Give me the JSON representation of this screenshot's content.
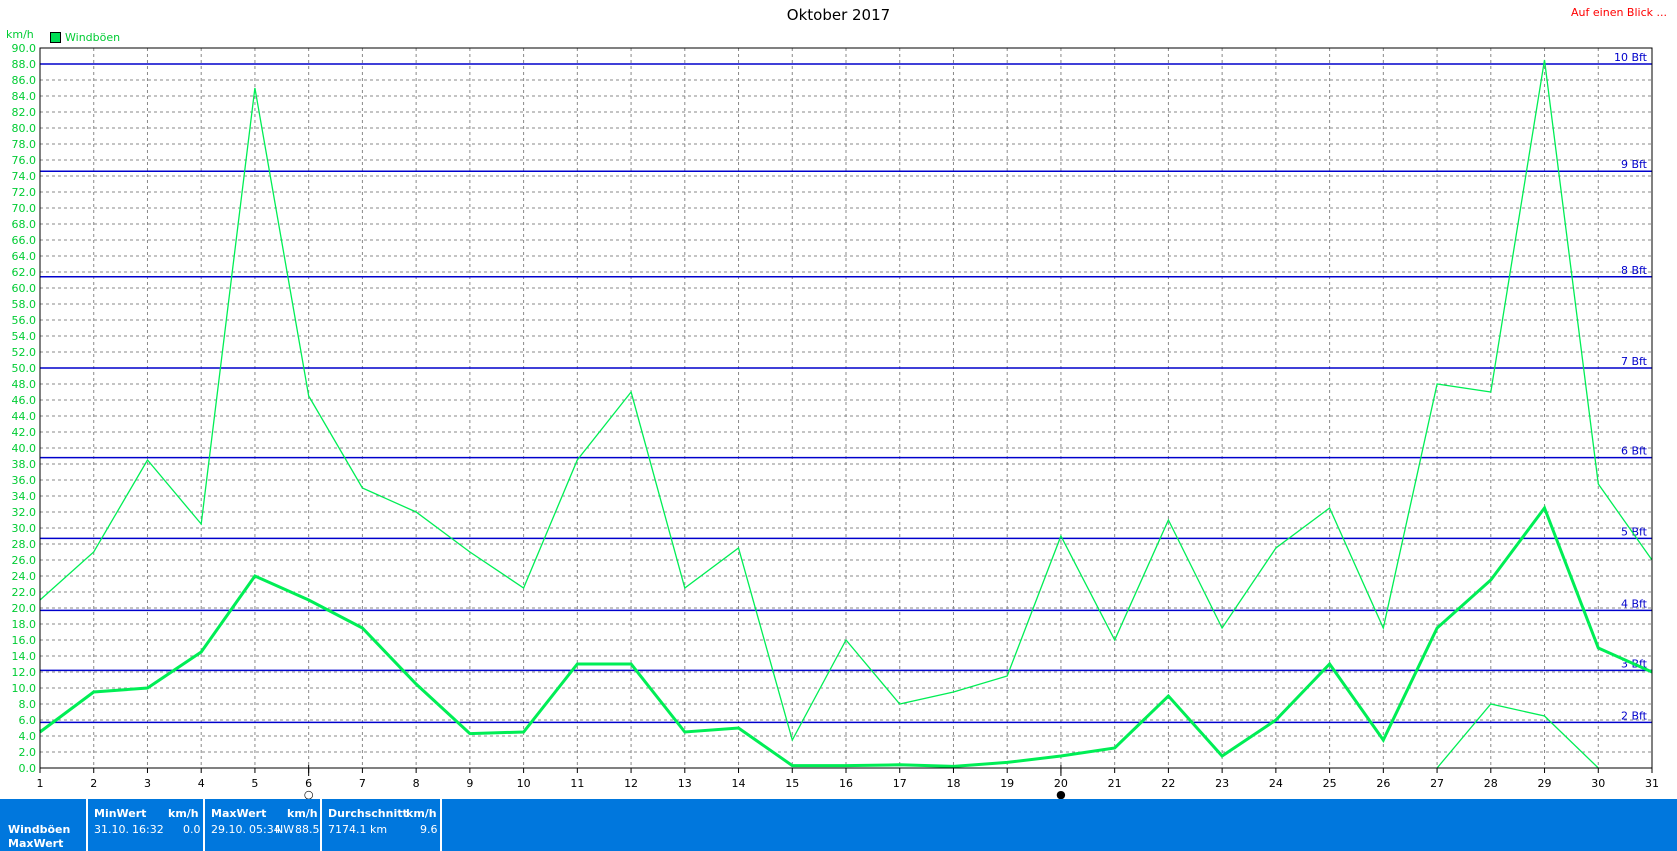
{
  "header": {
    "title": "Oktober 2017",
    "link": "Auf einen Blick ...",
    "unit": "km/h"
  },
  "chart_data": {
    "type": "line",
    "title": "Oktober 2017",
    "ylabel": "km/h",
    "ylim": [
      0,
      90
    ],
    "x": [
      1,
      2,
      3,
      4,
      5,
      6,
      7,
      8,
      9,
      10,
      11,
      12,
      13,
      14,
      15,
      16,
      17,
      18,
      19,
      20,
      21,
      22,
      23,
      24,
      25,
      26,
      27,
      28,
      29,
      30,
      31
    ],
    "series": [
      {
        "name": "Windböen",
        "color": "#00ee55",
        "values": [
          21,
          27,
          38.5,
          30.5,
          85,
          46.5,
          35,
          32,
          27,
          22.5,
          38.5,
          47,
          22.5,
          27.5,
          3.5,
          16,
          8,
          9.5,
          11.5,
          29,
          16,
          31,
          17.5,
          27.5,
          32.5,
          17.5,
          48,
          47,
          88.5,
          35.5,
          26
        ]
      },
      {
        "color": "#00ee55",
        "bold": true,
        "values": [
          4.5,
          9.5,
          10,
          14.5,
          24,
          21,
          17.5,
          10.5,
          4.3,
          4.5,
          13,
          13,
          4.5,
          5,
          0.3,
          0.3,
          0.4,
          0.2,
          0.7,
          1.5,
          2.5,
          9,
          1.5,
          6,
          13,
          3.5,
          17.5,
          23.5,
          32.5,
          15,
          12
        ]
      },
      {
        "color": "#00ee55",
        "values": [
          null,
          null,
          null,
          null,
          null,
          null,
          null,
          null,
          null,
          null,
          null,
          null,
          null,
          null,
          null,
          null,
          null,
          null,
          null,
          null,
          null,
          null,
          null,
          null,
          null,
          null,
          0,
          8,
          6.5,
          0,
          null
        ]
      }
    ],
    "beaufort": [
      {
        "label": "10 Bft",
        "value": 88
      },
      {
        "label": "9 Bft",
        "value": 74.6
      },
      {
        "label": "8 Bft",
        "value": 61.4
      },
      {
        "label": "7 Bft",
        "value": 50
      },
      {
        "label": "6 Bft",
        "value": 38.8
      },
      {
        "label": "5 Bft",
        "value": 28.7
      },
      {
        "label": "4 Bft",
        "value": 19.7
      },
      {
        "label": "3 Bft",
        "value": 12.2
      },
      {
        "label": "2 Bft",
        "value": 5.7
      }
    ],
    "moon_phases": [
      {
        "day": 6,
        "symbol": "○",
        "name": "full-moon-icon"
      },
      {
        "day": 20,
        "symbol": "●",
        "name": "new-moon-icon"
      }
    ],
    "grid": true,
    "legend": "top-left"
  },
  "footer": {
    "row_label_1": "Windböen",
    "row_label_2": "MaxWert",
    "min": {
      "header": "MinWert",
      "unit": "km/h",
      "date": "31.10.",
      "time": "16:32",
      "value": "0.0"
    },
    "max": {
      "header": "MaxWert",
      "unit": "km/h",
      "date": "29.10.",
      "time": "05:34",
      "dir": "NW",
      "value": "88.5"
    },
    "avg": {
      "header": "Durchschnitt",
      "unit": "km/h",
      "distance": "7174.1 km",
      "value": "9.6"
    }
  }
}
